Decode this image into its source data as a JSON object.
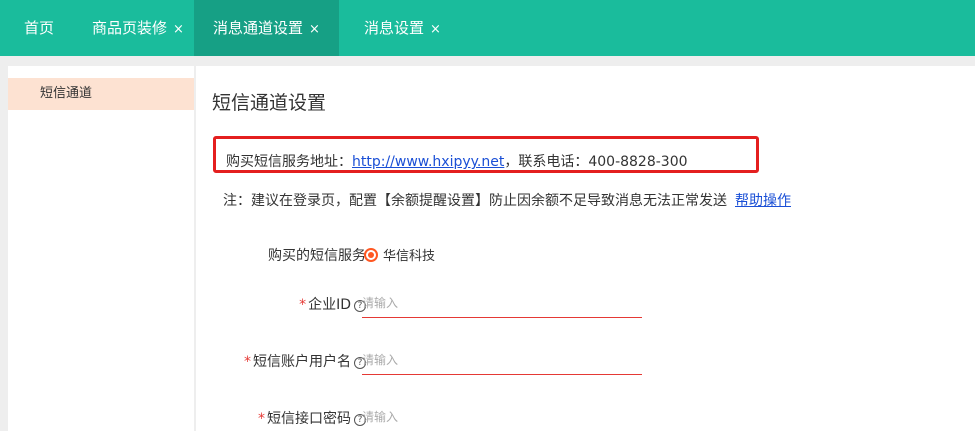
{
  "tabs": {
    "home": "首页",
    "decoration": "商品页装修",
    "channel": "消息通道设置",
    "message": "消息设置",
    "close_glyph": "×"
  },
  "sidebar": {
    "items": [
      {
        "label": "短信通道"
      }
    ]
  },
  "main": {
    "title": "短信通道设置",
    "purchase_label": "购买短信服务地址：",
    "purchase_url": "http://www.hxipyy.net",
    "phone_text": "，联系电话：400-8828-300",
    "note_text": "注：建议在登录页，配置【余额提醒设置】防止因余额不足导致消息无法正常发送",
    "help_link": "帮助操作"
  },
  "form": {
    "service_label": "购买的短信服务",
    "service_option": "华信科技",
    "required_mark": "*",
    "help_glyph": "?",
    "fields": [
      {
        "label": "企业ID",
        "placeholder": "请输入"
      },
      {
        "label": "短信账户用户名",
        "placeholder": "请输入"
      },
      {
        "label": "短信接口密码",
        "placeholder": "请输入"
      }
    ]
  },
  "colors": {
    "tabbar": "#1abc9c",
    "active_tab": "#16a085",
    "accent_red": "#e41f1f",
    "link": "#1a4fd6",
    "radio": "#ff5722"
  }
}
